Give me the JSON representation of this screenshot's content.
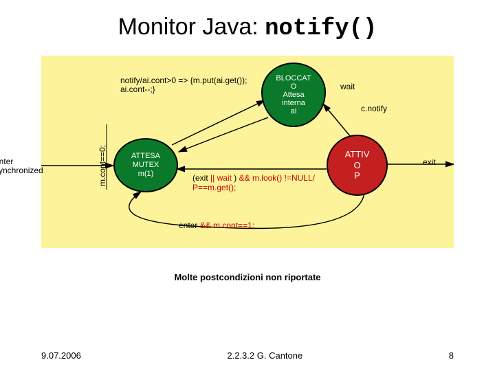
{
  "title_prefix": "Monitor Java: ",
  "title_code": "notify()",
  "nodes": {
    "bloccat": {
      "line1": "BLOCCAT",
      "line2": "O",
      "line3": "Attesa",
      "line4": "interna",
      "line5": "ai"
    },
    "attesa": {
      "line1": "ATTESA",
      "line2": "MUTEX",
      "line3": "m(1)"
    },
    "attiv": {
      "line1": "ATTIV",
      "line2": "O",
      "line3": "P"
    }
  },
  "edges": {
    "notify_guard": "notify/ai.cont>0 => {m.put(ai.get()); ai.cont--;}",
    "wait": "wait",
    "cnotify": "c.notify",
    "enter_sync": "enter\nsynchronized",
    "mcont0": "m.cont==0;",
    "exit_wait": "(exit || wait ) && m.look() !=NULL/ P==m.get();",
    "exit": "exit",
    "enter_loop": "enter && m.cont==1;"
  },
  "postcond": "Molte postcondizioni non riportate",
  "footer": {
    "date": "9.07.2006",
    "credit": "2.2.3.2 G. Cantone",
    "page": "8"
  }
}
